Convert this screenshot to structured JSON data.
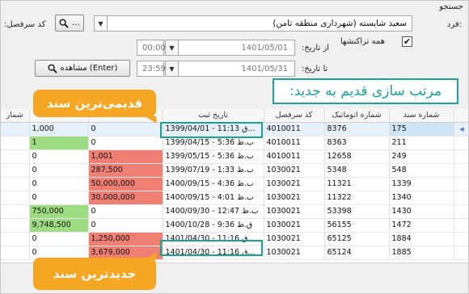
{
  "header": {
    "search_title": "جستجو"
  },
  "filters": {
    "person_label": "فرد:",
    "person_value": "سعید شایسته (شهرداری منطقه ثامن)",
    "account_code_label": "کد سرفصل:",
    "more_button": "...",
    "from_date_label": "از تاریخ:",
    "from_date_value": "1401/05/01",
    "from_time_value": "00:00",
    "to_date_label": "تا تاریخ:",
    "to_date_value": "1401/05/31",
    "to_time_value": "23:59",
    "all_transactions_label": "همه تراکنشها",
    "all_transactions_checked": true,
    "view_button": "مشاهده (Enter)"
  },
  "annotations": {
    "sort_note": "مرتب سازی قدیم به جدید:",
    "oldest_doc": "قدیمی‌ترین سند",
    "newest_doc": "جدیدترین سند"
  },
  "table": {
    "columns": [
      "شماره سند",
      "شماره اتوماتیک",
      "کد سرفصل",
      "تاریخ ثبت",
      "",
      "",
      "شمار"
    ],
    "rows": [
      {
        "doc": "175",
        "auto": "8376",
        "code": "4010011",
        "date": "1399/04/01 - 11:13 ق...",
        "debit": "0",
        "credit": "1,000",
        "credit_color": "green",
        "debit_color": "",
        "selected": true
      },
      {
        "doc": "211",
        "auto": "8363",
        "code": "4010011",
        "date": "1399/04/15 - 5:36 ب.ظ",
        "debit": "0",
        "credit": "1",
        "credit_color": "green",
        "debit_color": "",
        "selected": false
      },
      {
        "doc": "249",
        "auto": "12658",
        "code": "4010011",
        "date": "1399/05/15 - 5:36 ب.ظ",
        "debit": "1,001",
        "credit": "0",
        "credit_color": "",
        "debit_color": "red",
        "selected": false
      },
      {
        "doc": "548",
        "auto": "5348",
        "code": "1030021",
        "date": "1399/07/19 - 1:33 ب.ظ",
        "debit": "287,500",
        "credit": "0",
        "credit_color": "",
        "debit_color": "red",
        "selected": false
      },
      {
        "doc": "1339",
        "auto": "11321",
        "code": "1030021",
        "date": "1400/09/15 - 4:36 ب.ظ",
        "debit": "50,000,000",
        "credit": "0",
        "credit_color": "",
        "debit_color": "red",
        "selected": false
      },
      {
        "doc": "1340",
        "auto": "11322",
        "code": "1030021",
        "date": "1400/09/15 - 4:01 ب.ظ",
        "debit": "30,000,000",
        "credit": "0",
        "credit_color": "",
        "debit_color": "red",
        "selected": false
      },
      {
        "doc": "1430",
        "auto": "53398",
        "code": "1030021",
        "date": "1400/09/30 - 12:47 ب.ظ",
        "debit": "0",
        "credit": "750,000",
        "credit_color": "green",
        "debit_color": "",
        "selected": false
      },
      {
        "doc": "1472",
        "auto": "56155",
        "code": "1030021",
        "date": "1400/10/28 - 9:36 ق.ظ",
        "debit": "0",
        "credit": "9,748,500",
        "credit_color": "green",
        "debit_color": "",
        "selected": false
      },
      {
        "doc": "1884",
        "auto": "65125",
        "code": "1030021",
        "date": "1401/04/30 - 11:16 ق...",
        "debit": "1,250,000",
        "credit": "0",
        "credit_color": "",
        "debit_color": "red",
        "selected": false
      },
      {
        "doc": "1885",
        "auto": "65124",
        "code": "1030021",
        "date": "1401/04/30 - 11:16 ق...",
        "debit": "3,679,000",
        "credit": "0",
        "credit_color": "",
        "debit_color": "red",
        "selected": false
      }
    ]
  }
}
